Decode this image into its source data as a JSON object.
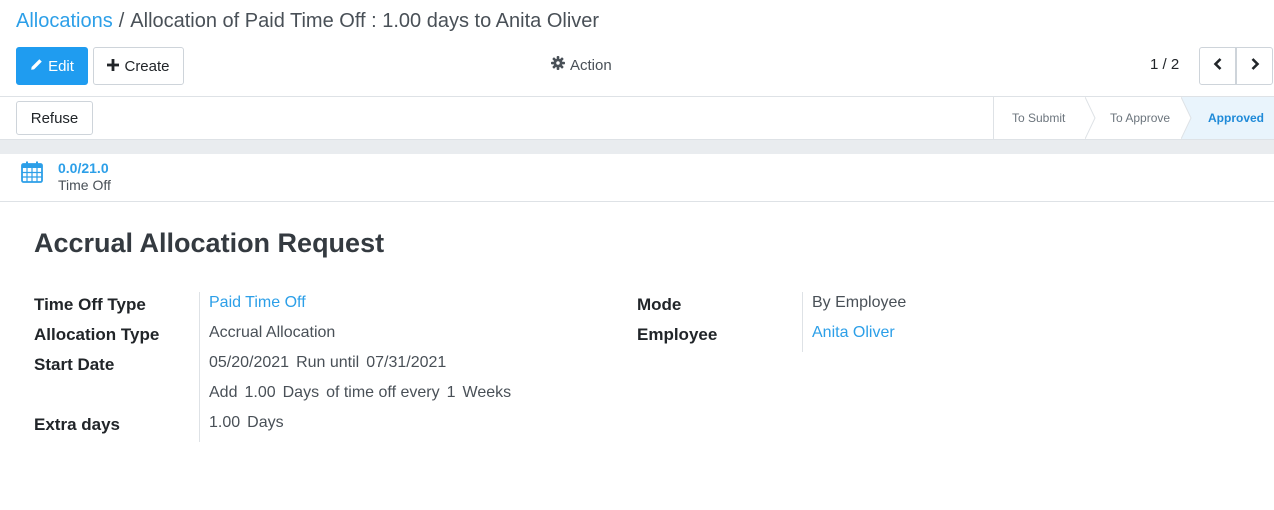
{
  "breadcrumb": {
    "parent": "Allocations",
    "separator": "/",
    "current": "Allocation of Paid Time Off : 1.00 days to Anita Oliver"
  },
  "toolbar": {
    "edit_label": "Edit",
    "create_label": "Create",
    "action_label": "Action"
  },
  "pager": {
    "value": "1 / 2"
  },
  "statusbar": {
    "refuse_label": "Refuse",
    "stages": [
      "To Submit",
      "To Approve",
      "Approved"
    ],
    "current_stage": "Approved"
  },
  "smart_button": {
    "value": "0.0/21.0",
    "label": "Time Off"
  },
  "form": {
    "title": "Accrual Allocation Request",
    "time_off_type": {
      "label": "Time Off Type",
      "value": "Paid Time Off"
    },
    "allocation_type": {
      "label": "Allocation Type",
      "value": "Accrual Allocation"
    },
    "start_date": {
      "label": "Start Date",
      "value": "05/20/2021",
      "run_until_label": "Run until",
      "run_until_value": "07/31/2021"
    },
    "accrual": {
      "add_label": "Add",
      "amount": "1.00",
      "unit": "Days",
      "every_label": "of time off every",
      "interval": "1",
      "interval_unit": "Weeks"
    },
    "extra_days": {
      "label": "Extra days",
      "value": "1.00",
      "unit": "Days"
    },
    "mode": {
      "label": "Mode",
      "value": "By Employee"
    },
    "employee": {
      "label": "Employee",
      "value": "Anita Oliver"
    }
  },
  "colors": {
    "primary": "#1f9cf0",
    "link": "#2c9fe8",
    "active_stage_bg": "#e9f4fc"
  },
  "icons": {
    "edit": "pencil-icon",
    "create": "plus-icon",
    "action": "gear-icon",
    "pager_prev": "chevron-left-icon",
    "pager_next": "chevron-right-icon",
    "smart_button": "calendar-icon"
  }
}
